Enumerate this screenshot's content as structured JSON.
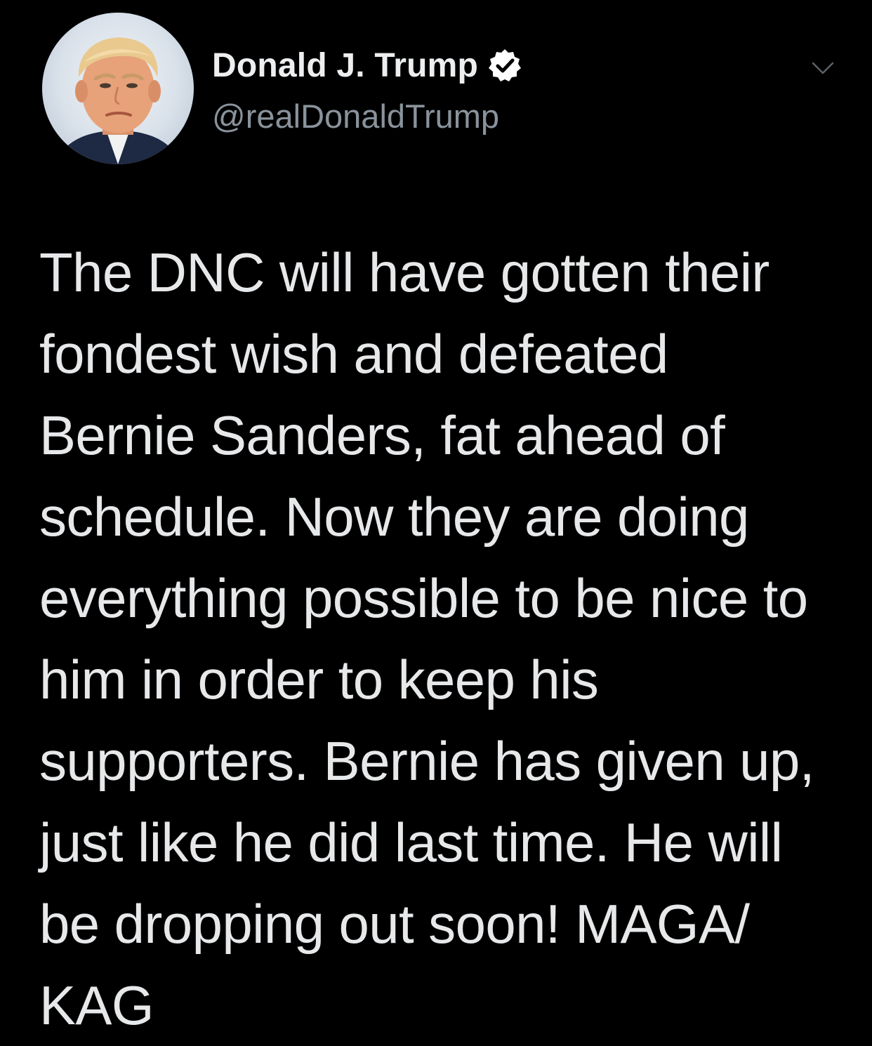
{
  "tweet": {
    "author": {
      "display_name": "Donald J. Trump",
      "handle": "@realDonaldTrump",
      "verified": true,
      "verified_icon": "verified-badge-icon"
    },
    "menu_icon": "chevron-down-icon",
    "lines": [
      "The DNC will have gotten their",
      "fondest wish and defeated",
      "Bernie Sanders, fat ahead of",
      "schedule. Now they are doing",
      "everything possible to be nice to",
      "him in order to keep his",
      "supporters. Bernie has given up,",
      "just like he did last time. He will",
      "be dropping out soon! MAGA/",
      "KAG"
    ]
  },
  "colors": {
    "background": "#000000",
    "text": "#e6e8ea",
    "secondary_text": "#8a939c"
  }
}
